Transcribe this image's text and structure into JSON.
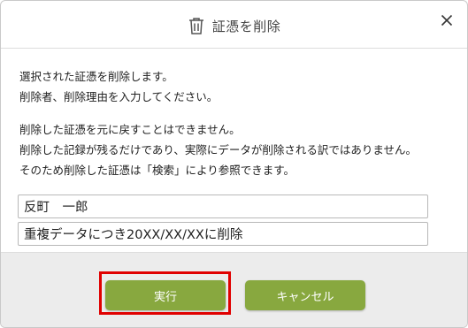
{
  "dialog": {
    "title": "証憑を削除",
    "title_icon": "trash-icon",
    "close_icon": "close-icon",
    "message1": [
      "選択された証憑を削除します。",
      "削除者、削除理由を入力してください。"
    ],
    "message2": [
      "削除した証憑を元に戻すことはできません。",
      "削除した記録が残るだけであり、実際にデータが削除される訳ではありません。",
      "そのため削除した証憑は「検索」により参照できます。"
    ]
  },
  "form": {
    "deleter_value": "反町　一郎",
    "reason_value": "重複データにつき20XX/XX/XXに削除"
  },
  "buttons": {
    "execute_label": "実行",
    "cancel_label": "キャンセル"
  },
  "colors": {
    "button_green": "#88a83f",
    "highlight_red": "#e00000",
    "footer_bg": "#ececec"
  }
}
